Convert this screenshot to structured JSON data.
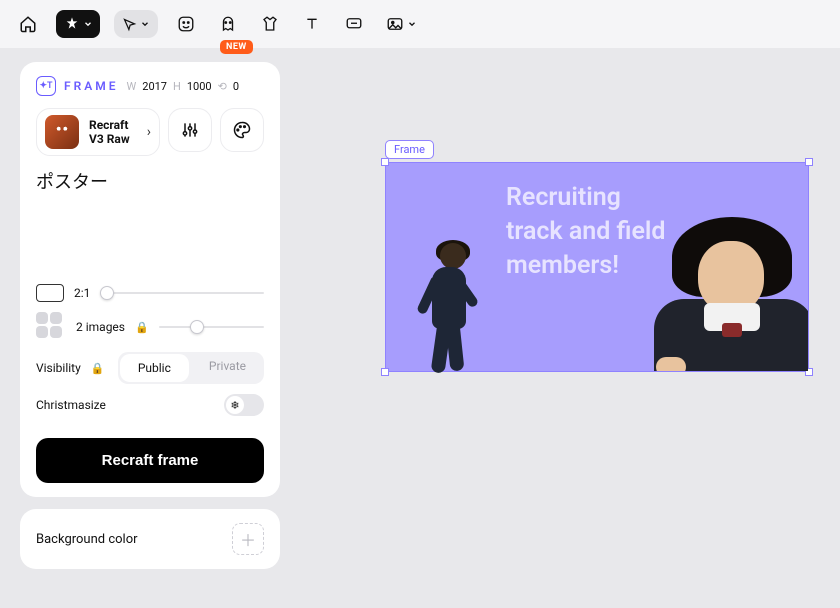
{
  "toolbar": {
    "new_badge": "NEW"
  },
  "panel": {
    "frame_label": "FRAME",
    "w_label": "W",
    "w_value": "2017",
    "h_label": "H",
    "h_value": "1000",
    "r_label": "⟲",
    "r_value": "0",
    "model_line1": "Recraft",
    "model_line2": "V3 Raw",
    "prompt": "ポスター",
    "aspect_label": "2:1",
    "images_label": "2 images",
    "visibility_label": "Visibility",
    "visibility_public": "Public",
    "visibility_private": "Private",
    "christmasize_label": "Christmasize",
    "recraft_button": "Recraft frame",
    "bg_label": "Background color"
  },
  "canvas": {
    "frame_tag": "Frame",
    "frame_text": "Recruiting\ntrack and field\nmembers!"
  }
}
